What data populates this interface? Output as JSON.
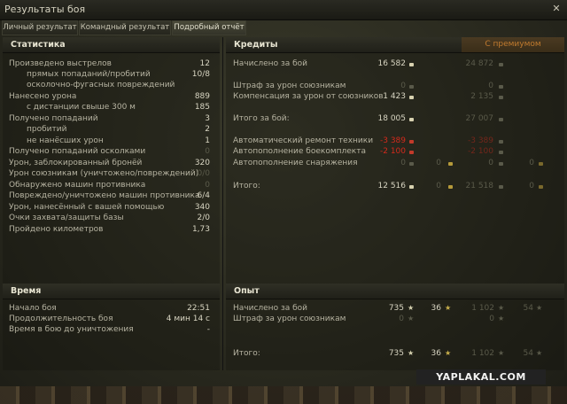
{
  "window": {
    "title": "Результаты боя",
    "close_glyph": "✕"
  },
  "tabs": [
    {
      "label": "Личный результат"
    },
    {
      "label": "Командный результат"
    },
    {
      "label": "Подробный отчёт"
    }
  ],
  "stats": {
    "header": "Статистика",
    "rows": [
      {
        "label": "Произведено выстрелов",
        "value": "12"
      },
      {
        "label": "прямых попаданий/пробитий",
        "value": "10/8"
      },
      {
        "label": "осколочно-фугасных повреждений",
        "value": ""
      },
      {
        "label": "Нанесено урона",
        "value": "889"
      },
      {
        "label": "с дистанции свыше 300 м",
        "value": "185"
      },
      {
        "label": "Получено попаданий",
        "value": "3"
      },
      {
        "label": "пробитий",
        "value": "2"
      },
      {
        "label": "не нанёсших урон",
        "value": "1"
      },
      {
        "label": "Получено попаданий осколками",
        "value": "0"
      },
      {
        "label": "Урон, заблокированный бронёй",
        "value": "320"
      },
      {
        "label": "Урон союзникам (уничтожено/повреждений)",
        "value": "0/0"
      },
      {
        "label": "Обнаружено машин противника",
        "value": "0"
      },
      {
        "label": "Повреждено/уничтожено машин противника",
        "value": "6/4"
      },
      {
        "label": "Урон, нанесённый с вашей помощью",
        "value": "340"
      },
      {
        "label": "Очки захвата/защиты базы",
        "value": "2/0"
      },
      {
        "label": "Пройдено километров",
        "value": "1,73"
      }
    ]
  },
  "credits": {
    "header": "Кредиты",
    "premium_header": "С премиумом",
    "rows": [
      {
        "label": "Начислено за бой",
        "value": "16 582",
        "premium": "24 872"
      },
      {
        "label": "Штраф за урон союзникам",
        "value": "0",
        "premium": "0"
      },
      {
        "label": "Компенсация за урон от союзников",
        "value": "1 423",
        "premium": "2 135"
      },
      {
        "label": "Итого за бой:",
        "value": "18 005",
        "premium": "27 007"
      },
      {
        "label": "Автоматический ремонт техники",
        "value": "-3 389",
        "premium": "-3 389"
      },
      {
        "label": "Автопополнение боекомплекта",
        "value": "-2 100",
        "premium": "-2 100"
      },
      {
        "label": "Автопополнение снаряжения",
        "value": "0",
        "gold": "0",
        "premium": "0",
        "premium_gold": "0"
      },
      {
        "label": "Итого:",
        "value": "12 516",
        "gold": "0",
        "premium": "21 518",
        "premium_gold": "0"
      }
    ]
  },
  "time": {
    "header": "Время",
    "rows": [
      {
        "label": "Начало боя",
        "value": "22:51"
      },
      {
        "label": "Продолжительность боя",
        "value": "4 мин 14 с"
      },
      {
        "label": "Время в бою до уничтожения",
        "value": "-"
      }
    ]
  },
  "experience": {
    "header": "Опыт",
    "rows": [
      {
        "label": "Начислено за бой",
        "xp": "735",
        "free_xp": "36",
        "premium_xp": "1 102",
        "premium_free": "54"
      },
      {
        "label": "Штраф за урон союзникам",
        "xp": "0",
        "premium_xp": "0"
      },
      {
        "label": "Итого:",
        "xp": "735",
        "free_xp": "36",
        "premium_xp": "1 102",
        "premium_free": "54"
      }
    ]
  },
  "watermark": "YAPLAKAL.COM",
  "colors": {
    "negative": "#d22a1c",
    "premium_accent": "#c07a2e"
  }
}
